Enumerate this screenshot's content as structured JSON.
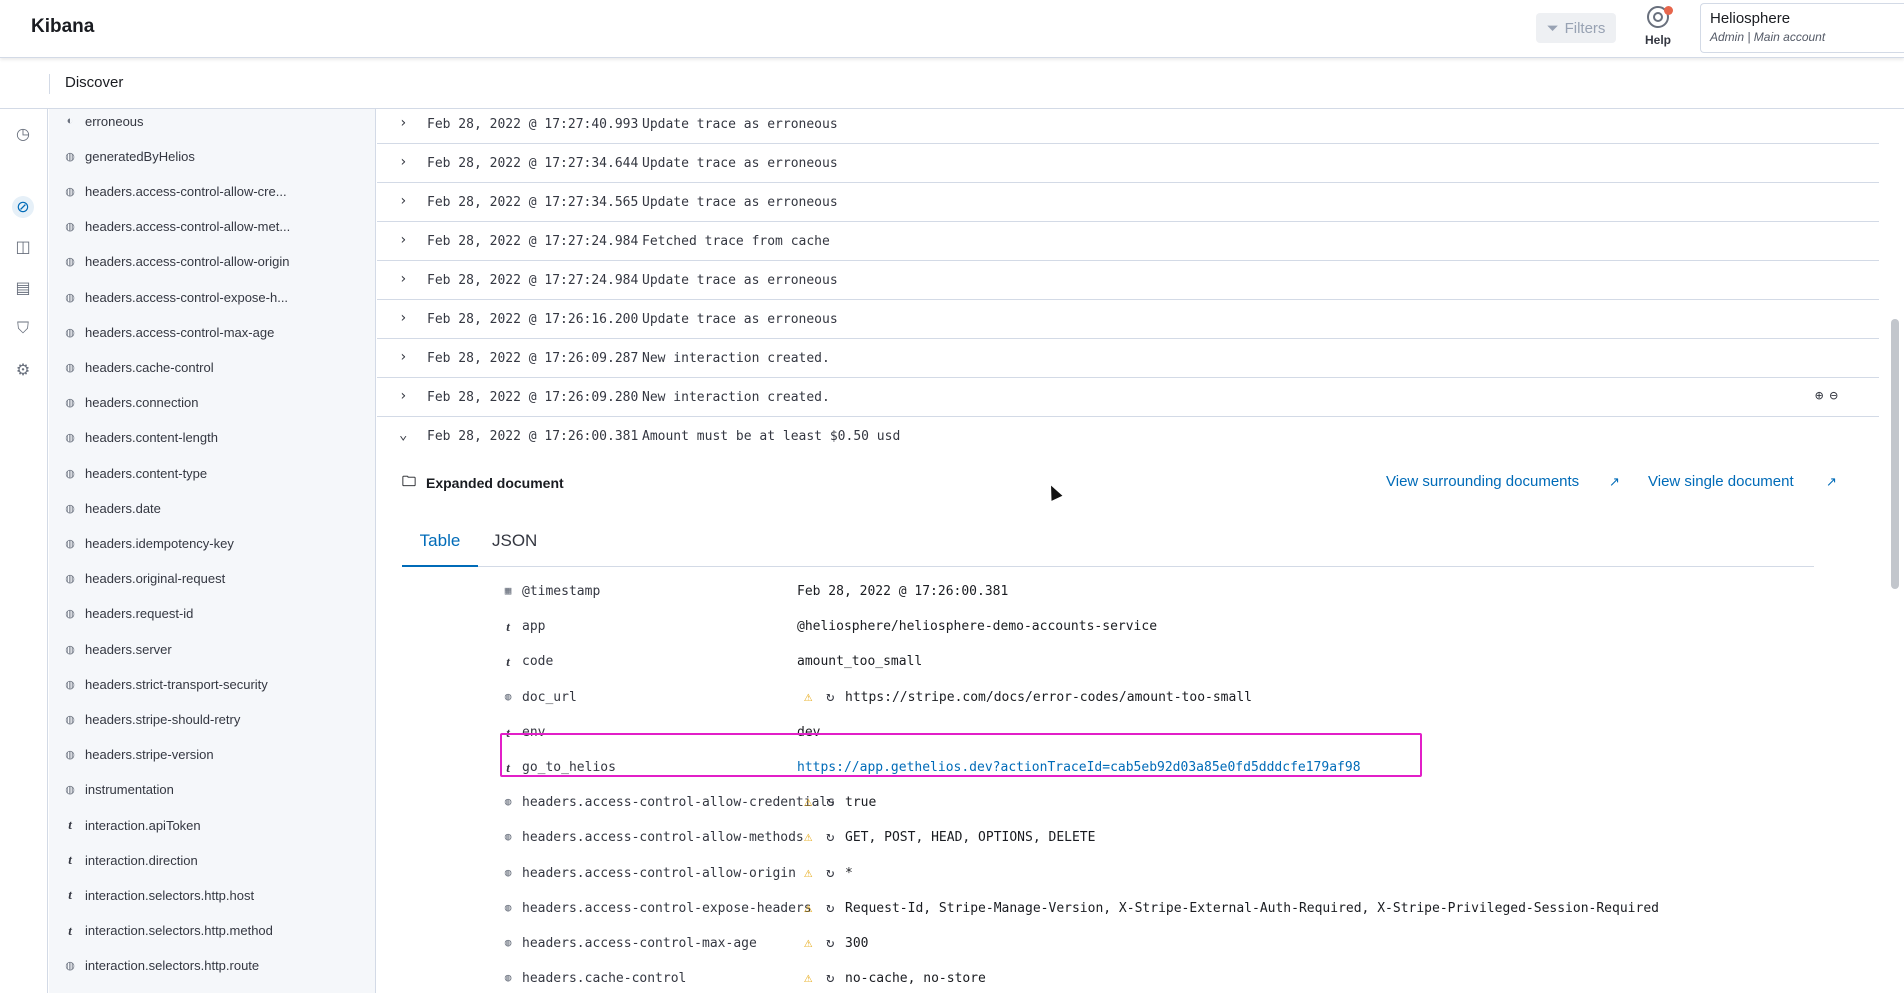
{
  "header": {
    "logo": "Kibana",
    "filters_label": "Filters",
    "help_label": "Help",
    "account_name": "Heliosphere",
    "account_role": "Admin  |  Main account"
  },
  "breadcrumb": {
    "title": "Discover"
  },
  "fields": [
    {
      "type": "o",
      "name": "erroneous"
    },
    {
      "type": "o",
      "name": "generatedByHelios"
    },
    {
      "type": "o",
      "name": "headers.access-control-allow-cre..."
    },
    {
      "type": "o",
      "name": "headers.access-control-allow-met..."
    },
    {
      "type": "o",
      "name": "headers.access-control-allow-origin"
    },
    {
      "type": "o",
      "name": "headers.access-control-expose-h..."
    },
    {
      "type": "o",
      "name": "headers.access-control-max-age"
    },
    {
      "type": "o",
      "name": "headers.cache-control"
    },
    {
      "type": "o",
      "name": "headers.connection"
    },
    {
      "type": "o",
      "name": "headers.content-length"
    },
    {
      "type": "o",
      "name": "headers.content-type"
    },
    {
      "type": "o",
      "name": "headers.date"
    },
    {
      "type": "o",
      "name": "headers.idempotency-key"
    },
    {
      "type": "o",
      "name": "headers.original-request"
    },
    {
      "type": "o",
      "name": "headers.request-id"
    },
    {
      "type": "o",
      "name": "headers.server"
    },
    {
      "type": "o",
      "name": "headers.strict-transport-security"
    },
    {
      "type": "o",
      "name": "headers.stripe-should-retry"
    },
    {
      "type": "o",
      "name": "headers.stripe-version"
    },
    {
      "type": "o",
      "name": "instrumentation"
    },
    {
      "type": "t",
      "name": "interaction.apiToken"
    },
    {
      "type": "t",
      "name": "interaction.direction"
    },
    {
      "type": "t",
      "name": "interaction.selectors.http.host"
    },
    {
      "type": "t",
      "name": "interaction.selectors.http.method"
    },
    {
      "type": "o",
      "name": "interaction.selectors.http.route"
    }
  ],
  "rows": [
    {
      "ts": "Feb 28, 2022 @ 17:27:40.993",
      "msg": "Update trace as erroneous"
    },
    {
      "ts": "Feb 28, 2022 @ 17:27:34.644",
      "msg": "Update trace as erroneous"
    },
    {
      "ts": "Feb 28, 2022 @ 17:27:34.565",
      "msg": "Update trace as erroneous"
    },
    {
      "ts": "Feb 28, 2022 @ 17:27:24.984",
      "msg": "Fetched trace from cache"
    },
    {
      "ts": "Feb 28, 2022 @ 17:27:24.984",
      "msg": "Update trace as erroneous"
    },
    {
      "ts": "Feb 28, 2022 @ 17:26:16.200",
      "msg": "Update trace as erroneous"
    },
    {
      "ts": "Feb 28, 2022 @ 17:26:09.287",
      "msg": "New interaction created."
    },
    {
      "ts": "Feb 28, 2022 @ 17:26:09.280",
      "msg": "New interaction created."
    },
    {
      "ts": "Feb 28, 2022 @ 17:26:00.381",
      "msg": "Amount must be at least $0.50 usd"
    }
  ],
  "expanded": {
    "title": "Expanded document",
    "surrounding_link": "View surrounding documents",
    "single_link": "View single document",
    "tabs": [
      "Table",
      "JSON"
    ],
    "fields": [
      {
        "type": "cal",
        "key": "@timestamp",
        "value": "Feb 28, 2022 @ 17:26:00.381",
        "warn": false
      },
      {
        "type": "t",
        "key": "app",
        "value": "@heliosphere/heliosphere-demo-accounts-service",
        "warn": false
      },
      {
        "type": "t",
        "key": "code",
        "value": "amount_too_small",
        "warn": false
      },
      {
        "type": "o",
        "key": "doc_url",
        "value": "https://stripe.com/docs/error-codes/amount-too-small",
        "warn": true
      },
      {
        "type": "t",
        "key": "env",
        "value": "dev",
        "warn": false
      },
      {
        "type": "t",
        "key": "go_to_helios",
        "value": "https://app.gethelios.dev?actionTraceId=cab5eb92d03a85e0fd5dddcfe179af98",
        "warn": false,
        "link": true
      },
      {
        "type": "o",
        "key": "headers.access-control-allow-credentials",
        "value": "true",
        "warn": true
      },
      {
        "type": "o",
        "key": "headers.access-control-allow-methods",
        "value": "GET, POST, HEAD, OPTIONS, DELETE",
        "warn": true
      },
      {
        "type": "o",
        "key": "headers.access-control-allow-origin",
        "value": "*",
        "warn": true
      },
      {
        "type": "o",
        "key": "headers.access-control-expose-headers",
        "value": "Request-Id, Stripe-Manage-Version, X-Stripe-External-Auth-Required, X-Stripe-Privileged-Session-Required",
        "warn": true
      },
      {
        "type": "o",
        "key": "headers.access-control-max-age",
        "value": "300",
        "warn": true
      },
      {
        "type": "o",
        "key": "headers.cache-control",
        "value": "no-cache, no-store",
        "warn": true
      }
    ]
  },
  "colors": {
    "accent": "#006bb8",
    "highlight": "#e21fc8",
    "warning": "#e5a50a"
  }
}
